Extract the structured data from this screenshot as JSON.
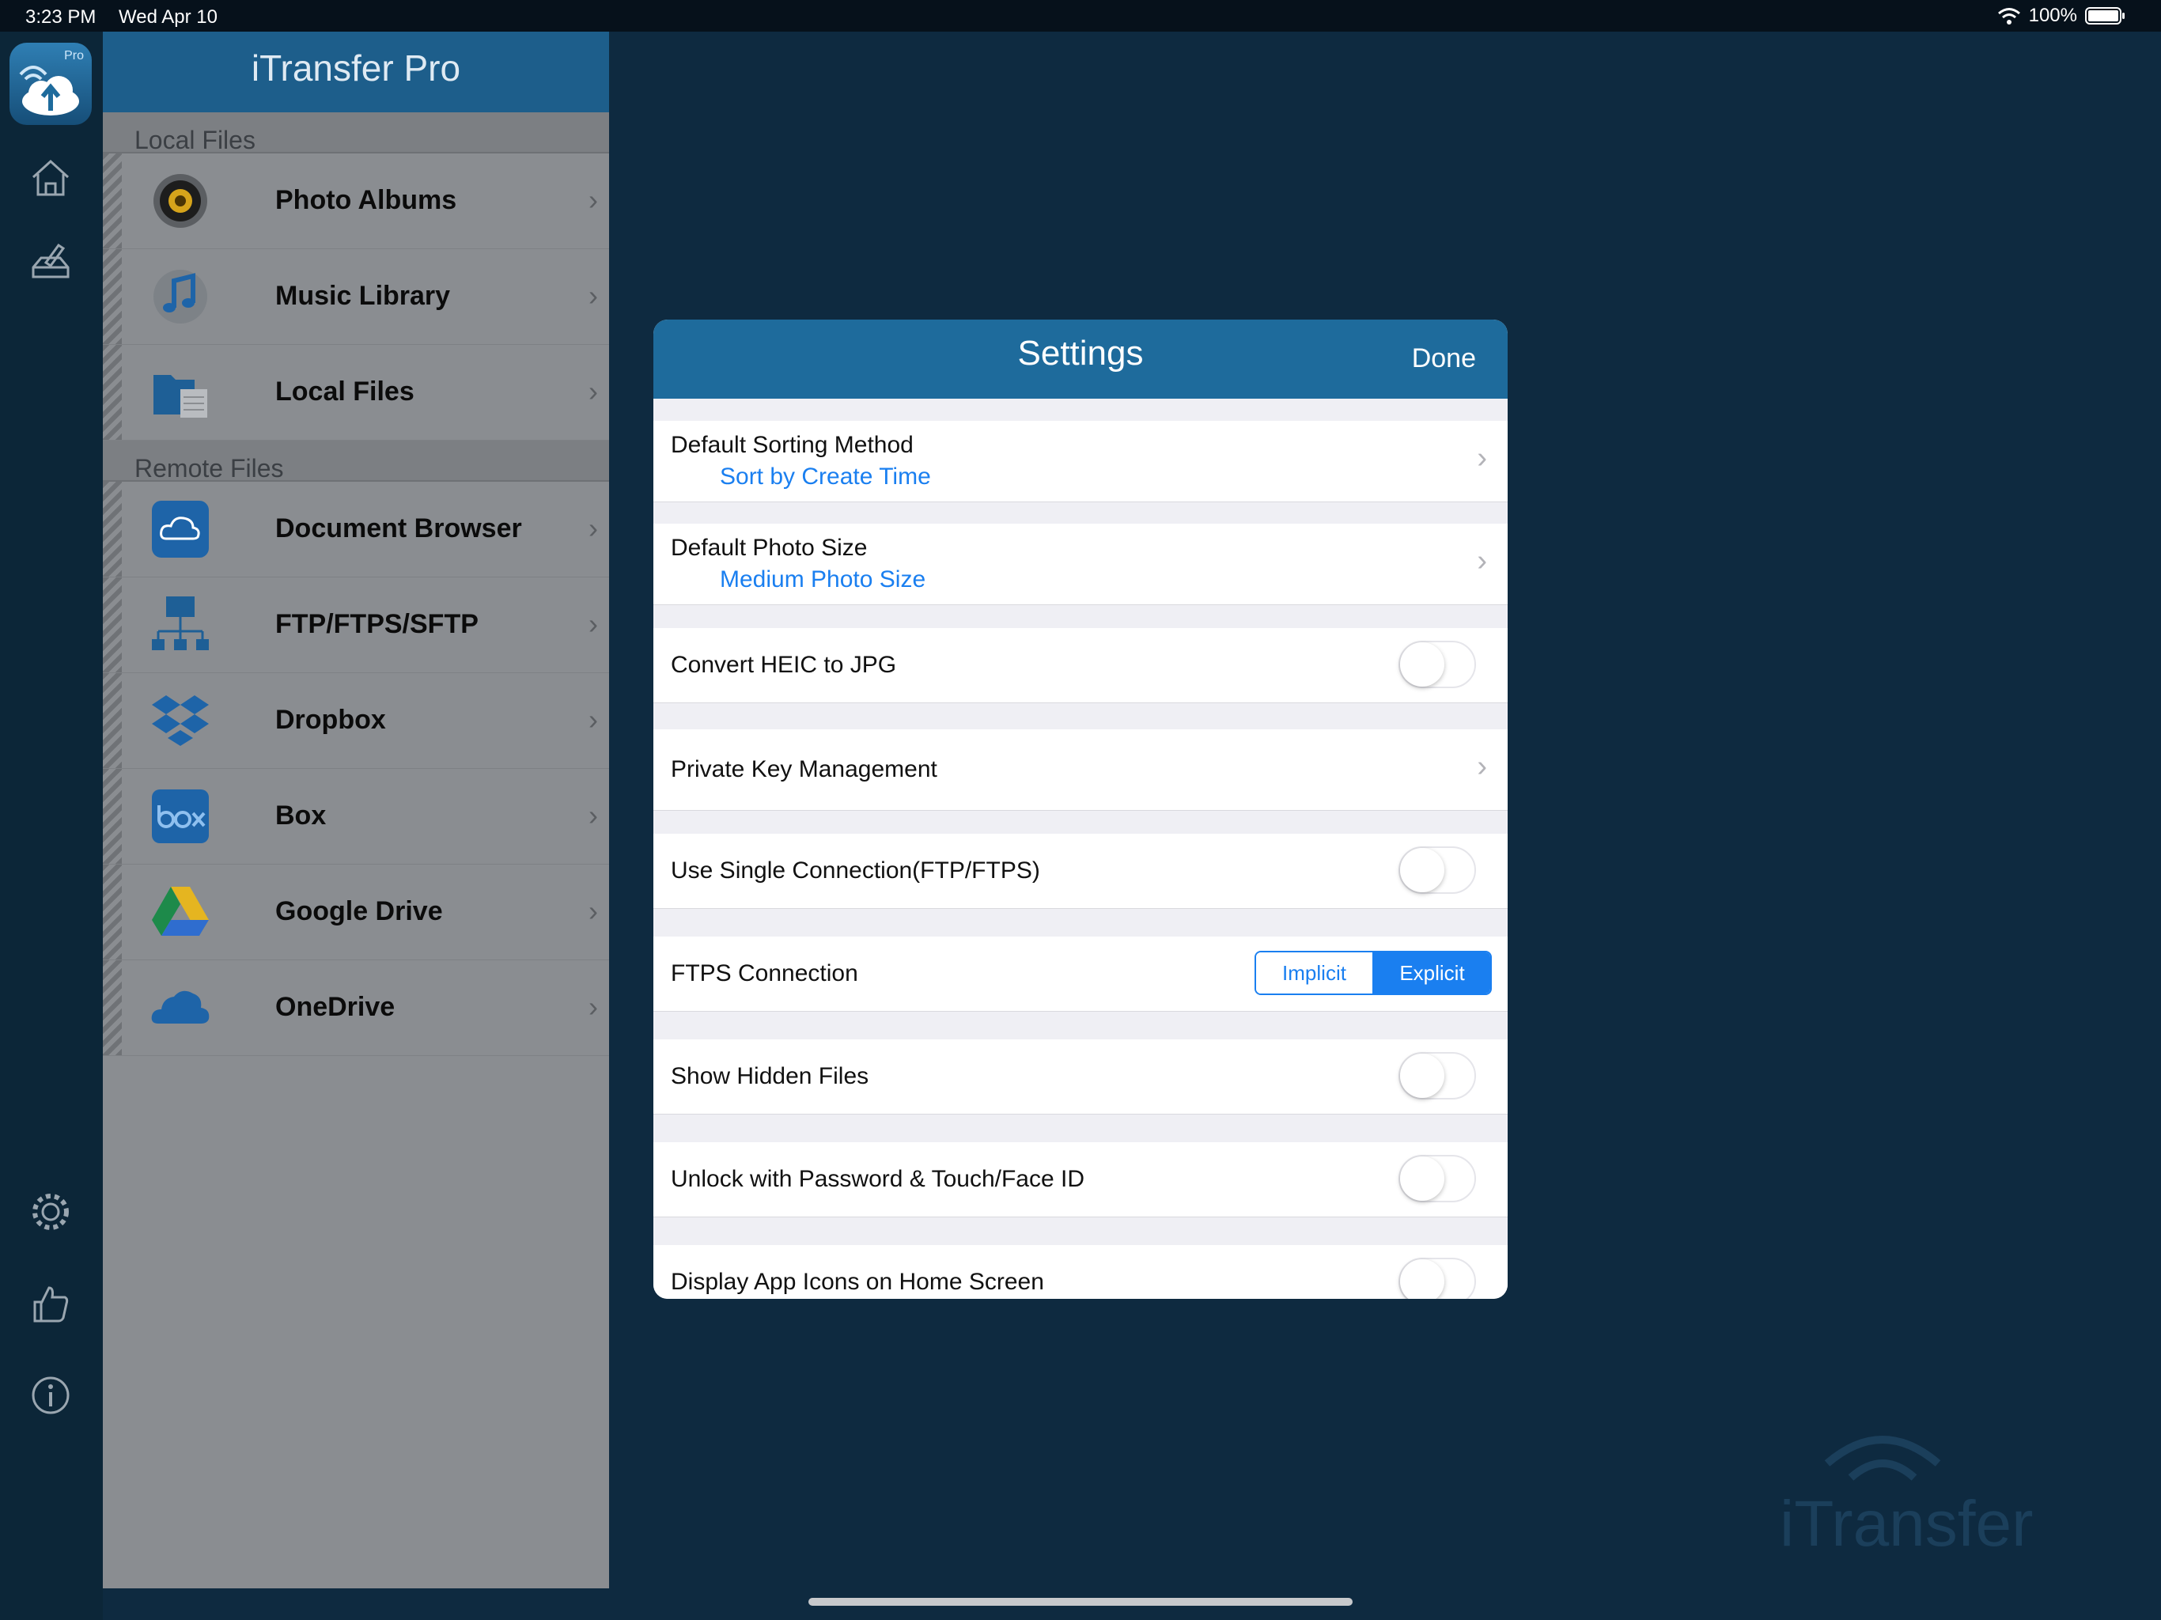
{
  "status": {
    "time": "3:23 PM",
    "date": "Wed Apr 10",
    "battery": "100%"
  },
  "rail": {
    "logo_badge": "Pro"
  },
  "sidebar": {
    "title": "iTransfer Pro",
    "local_header": "Local Files",
    "local_items": [
      {
        "label": "Photo Albums",
        "icon": "photo-albums-icon"
      },
      {
        "label": "Music Library",
        "icon": "music-library-icon"
      },
      {
        "label": "Local Files",
        "icon": "local-files-icon"
      }
    ],
    "remote_header": "Remote Files",
    "remote_items": [
      {
        "label": "Document Browser",
        "icon": "document-browser-icon"
      },
      {
        "label": "FTP/FTPS/SFTP",
        "icon": "ftp-icon"
      },
      {
        "label": "Dropbox",
        "icon": "dropbox-icon"
      },
      {
        "label": "Box",
        "icon": "box-icon"
      },
      {
        "label": "Google Drive",
        "icon": "google-drive-icon"
      },
      {
        "label": "OneDrive",
        "icon": "onedrive-icon"
      }
    ]
  },
  "watermark": "iTransfer",
  "settings": {
    "title": "Settings",
    "done": "Done",
    "sorting_label": "Default Sorting Method",
    "sorting_value": "Sort by Create Time",
    "photo_size_label": "Default Photo Size",
    "photo_size_value": "Medium Photo Size",
    "heic_label": "Convert HEIC to JPG",
    "heic_on": false,
    "private_key_label": "Private Key Management",
    "single_conn_label": "Use Single Connection(FTP/FTPS)",
    "single_conn_on": false,
    "ftps_label": "FTPS Connection",
    "ftps_options": [
      "Implicit",
      "Explicit"
    ],
    "ftps_selected": "Explicit",
    "hidden_label": "Show Hidden Files",
    "hidden_on": false,
    "unlock_label": "Unlock with Password & Touch/Face ID",
    "unlock_on": false,
    "icons_label": "Display App Icons on Home Screen",
    "icons_on": false
  },
  "colors": {
    "accent": "#1a7ff0",
    "header_blue": "#1e6b9c",
    "background": "#0e2a40"
  }
}
